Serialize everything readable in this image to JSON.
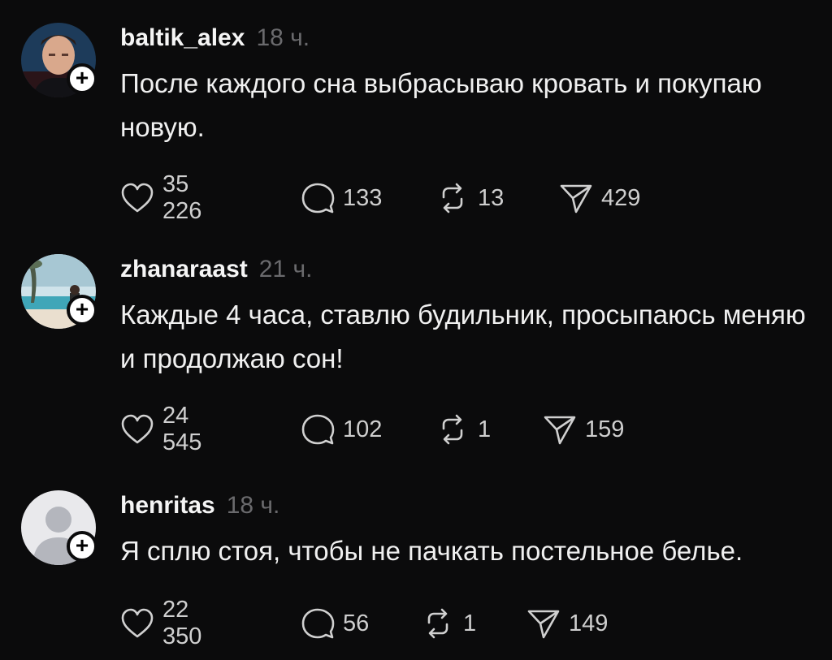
{
  "posts": [
    {
      "username": "baltik_alex",
      "time": "18 ч.",
      "text": "После каждого сна выбрасываю кровать и покупаю новую.",
      "likes": "35 226",
      "comments": "133",
      "reposts": "13",
      "shares": "429",
      "avatar_icon": "person-photo"
    },
    {
      "username": "zhanaraast",
      "time": "21 ч.",
      "text": "Каждые 4 часа, ставлю будильник, просыпаюсь меняю и продолжаю сон!",
      "likes": "24 545",
      "comments": "102",
      "reposts": "1",
      "shares": "159",
      "avatar_icon": "beach-photo"
    },
    {
      "username": "henritas",
      "time": "18 ч.",
      "text": "Я сплю стоя, чтобы не пачкать постельное белье.",
      "likes": "22 350",
      "comments": "56",
      "reposts": "1",
      "shares": "149",
      "avatar_icon": "default-user-icon"
    }
  ],
  "follow_symbol": "+",
  "colors": {
    "background": "#0b0b0c",
    "text": "#f0f0f0",
    "muted": "#6a6a6d",
    "icon": "#d0d0d0"
  }
}
